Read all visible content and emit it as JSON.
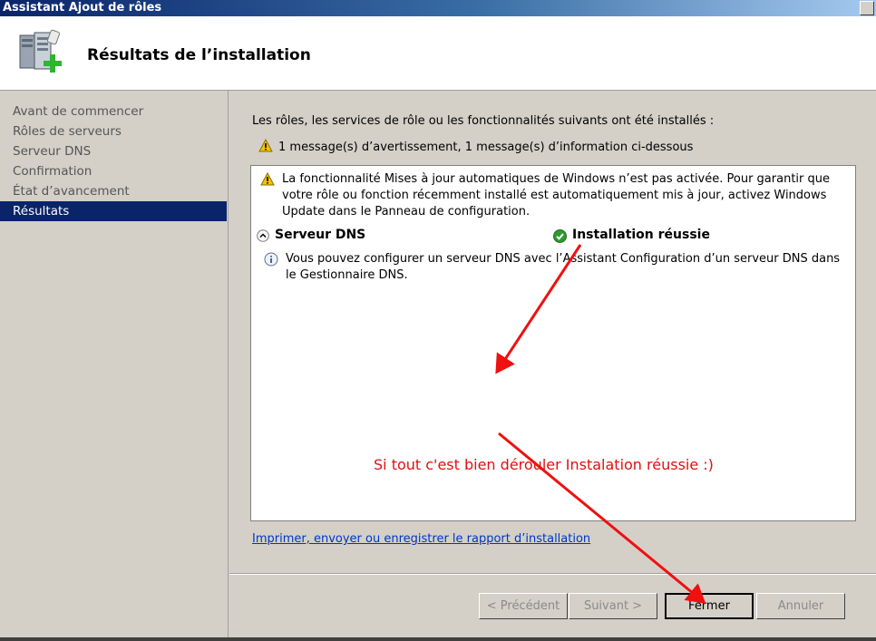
{
  "window": {
    "title": "Assistant Ajout de rôles"
  },
  "header": {
    "title": "Résultats de l’installation",
    "icon": "server-add-icon"
  },
  "sidebar": {
    "items": [
      {
        "label": "Avant de commencer"
      },
      {
        "label": "Rôles de serveurs"
      },
      {
        "label": "Serveur DNS"
      },
      {
        "label": "Confirmation"
      },
      {
        "label": "État d’avancement"
      },
      {
        "label": "Résultats"
      }
    ],
    "active_index": 5
  },
  "main": {
    "intro": "Les rôles, les services de rôle ou les fonctionnalités suivants ont été installés :",
    "summary": "1 message(s) d’avertissement, 1 message(s) d’information ci-dessous",
    "warning_message": "La fonctionnalité Mises à jour automatiques de Windows n’est pas activée. Pour garantir que votre rôle ou fonction récemment installé est automatiquement mis à jour, activez Windows Update dans le Panneau de configuration.",
    "section": {
      "title": "Serveur DNS",
      "status": "Installation réussie",
      "info_message": "Vous pouvez configurer un serveur DNS avec l’Assistant Configuration d’un serveur DNS dans le Gestionnaire DNS."
    },
    "annotation": "Si tout c'est bien dérouler Instalation réussie :)",
    "report_link": "Imprimer, envoyer ou enregistrer le rapport d’installation"
  },
  "footer": {
    "prev_label": "< Précédent",
    "next_label": "Suivant >",
    "close_label": "Fermer",
    "cancel_label": "Annuler"
  },
  "colors": {
    "selection": "#0a246a",
    "annotation": "#e01010",
    "link": "#0033cc",
    "success": "#2e9a2e",
    "warning": "#f2c200"
  }
}
